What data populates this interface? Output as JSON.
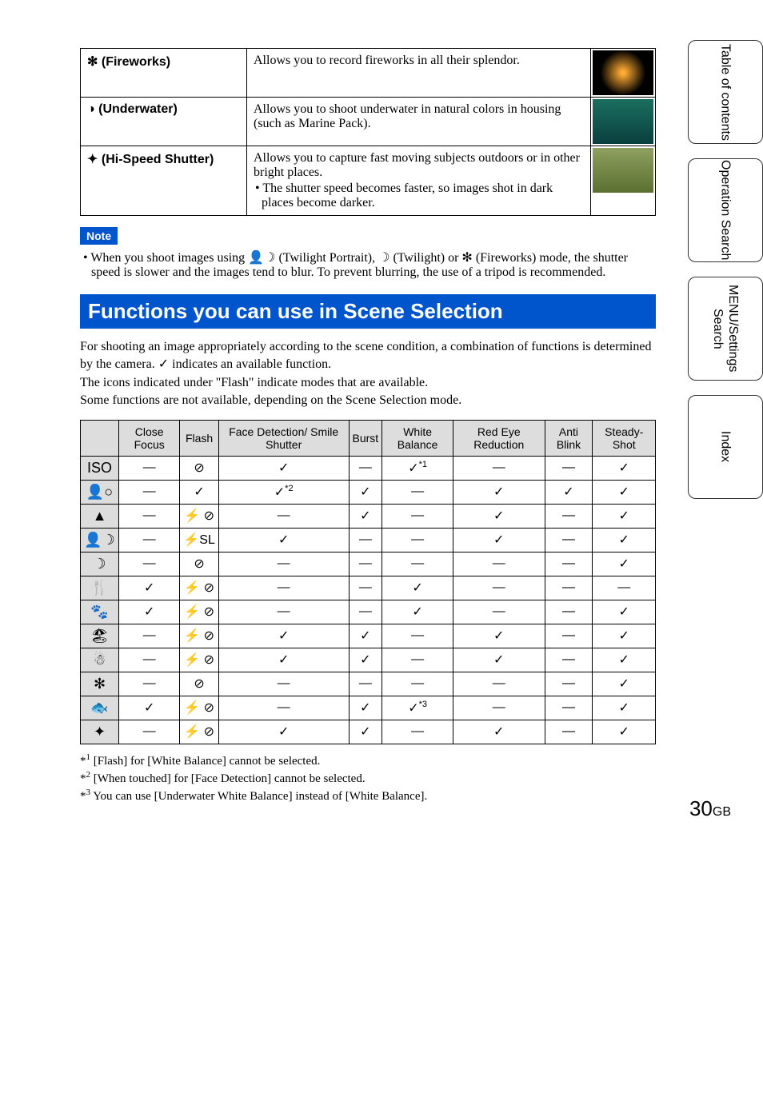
{
  "sidebar": {
    "tabs": [
      "Table of contents",
      "Operation Search",
      "MENU/Settings Search",
      "Index"
    ]
  },
  "scenes": [
    {
      "icon": "✻",
      "name": "(Fireworks)",
      "desc": "Allows you to record fireworks in all their splendor.",
      "thumb": "fireworks"
    },
    {
      "icon": "◑",
      "name": "(Underwater)",
      "desc": "Allows you to shoot underwater in natural colors in housing (such as Marine Pack).",
      "thumb": "under"
    },
    {
      "icon": "✦",
      "name": "(Hi-Speed Shutter)",
      "desc": "Allows you to capture fast moving subjects outdoors or in other bright places.",
      "bullet": "The shutter speed becomes faster, so images shot in dark places become darker.",
      "thumb": "shutter"
    }
  ],
  "note": {
    "label": "Note",
    "body_pre": "• When you shoot images using ",
    "body_mid1": " (Twilight Portrait), ",
    "body_mid2": " (Twilight) or ",
    "body_mid3": " (Fireworks) mode, the shutter speed is slower and the images tend to blur. To prevent blurring, the use of a tripod is recommended."
  },
  "section": {
    "title": "Functions you can use in Scene Selection",
    "intro1": "For shooting an image appropriately according to the scene condition, a combination of functions is determined by the camera. ✓ indicates an available function.",
    "intro2": "The icons indicated under \"Flash\" indicate modes that are available.",
    "intro3": "Some functions are not available, depending on the Scene Selection mode."
  },
  "chart_data": {
    "type": "table",
    "columns": [
      "",
      "Close Focus",
      "Flash",
      "Face Detection/ Smile Shutter",
      "Burst",
      "White Balance",
      "Red Eye Reduction",
      "Anti Blink",
      "Steady-Shot"
    ],
    "rows": [
      {
        "icon": "ISO",
        "cells": [
          "—",
          "⊘",
          "✓",
          "—",
          "✓*1",
          "—",
          "—",
          "✓"
        ]
      },
      {
        "icon": "👤○",
        "cells": [
          "—",
          "✓",
          "✓*2",
          "✓",
          "—",
          "✓",
          "✓",
          "✓"
        ]
      },
      {
        "icon": "▲",
        "cells": [
          "—",
          "⚡ ⊘",
          "—",
          "✓",
          "—",
          "✓",
          "—",
          "✓"
        ]
      },
      {
        "icon": "👤☽",
        "cells": [
          "—",
          "⚡SL",
          "✓",
          "—",
          "—",
          "✓",
          "—",
          "✓"
        ]
      },
      {
        "icon": "☽",
        "cells": [
          "—",
          "⊘",
          "—",
          "—",
          "—",
          "—",
          "—",
          "✓"
        ]
      },
      {
        "icon": "🍴",
        "cells": [
          "✓",
          "⚡ ⊘",
          "—",
          "—",
          "✓",
          "—",
          "—",
          "—"
        ]
      },
      {
        "icon": "🐾",
        "cells": [
          "✓",
          "⚡ ⊘",
          "—",
          "—",
          "✓",
          "—",
          "—",
          "✓"
        ]
      },
      {
        "icon": "🏖",
        "cells": [
          "—",
          "⚡ ⊘",
          "✓",
          "✓",
          "—",
          "✓",
          "—",
          "✓"
        ]
      },
      {
        "icon": "☃",
        "cells": [
          "—",
          "⚡ ⊘",
          "✓",
          "✓",
          "—",
          "✓",
          "—",
          "✓"
        ]
      },
      {
        "icon": "✻",
        "cells": [
          "—",
          "⊘",
          "—",
          "—",
          "—",
          "—",
          "—",
          "✓"
        ]
      },
      {
        "icon": "🐟",
        "cells": [
          "✓",
          "⚡ ⊘",
          "—",
          "✓",
          "✓*3",
          "—",
          "—",
          "✓"
        ]
      },
      {
        "icon": "✦",
        "cells": [
          "—",
          "⚡ ⊘",
          "✓",
          "✓",
          "—",
          "✓",
          "—",
          "✓"
        ]
      }
    ]
  },
  "footnotes": [
    "[Flash] for [White Balance] cannot be selected.",
    "[When touched] for [Face Detection] cannot be selected.",
    "You can use [Underwater White Balance] instead of [White Balance]."
  ],
  "page": {
    "num": "30",
    "suffix": "GB"
  }
}
